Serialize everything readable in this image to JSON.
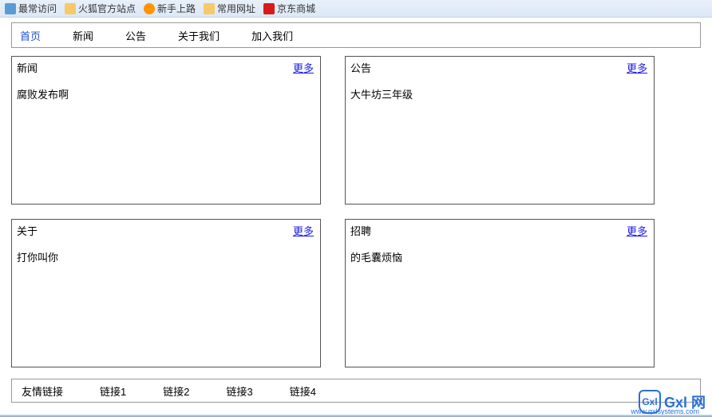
{
  "bookmarks": [
    {
      "label": "最常访问",
      "icon": "ico-blue"
    },
    {
      "label": "火狐官方站点",
      "icon": "ico-folder"
    },
    {
      "label": "新手上路",
      "icon": "ico-ff"
    },
    {
      "label": "常用网址",
      "icon": "ico-folder"
    },
    {
      "label": "京东商城",
      "icon": "ico-jd"
    }
  ],
  "nav": {
    "items": [
      "首页",
      "新闻",
      "公告",
      "关于我们",
      "加入我们"
    ],
    "active_index": 0
  },
  "more_label": "更多",
  "cards": [
    {
      "title": "新闻",
      "body": "腐败发布啊"
    },
    {
      "title": "公告",
      "body": "大牛坊三年级"
    },
    {
      "title": "关于",
      "body": "打你叫你"
    },
    {
      "title": "招聘",
      "body": "的毛囊烦恼"
    }
  ],
  "footer": {
    "label": "友情链接",
    "links": [
      "链接1",
      "链接2",
      "链接3",
      "链接4"
    ]
  },
  "watermark": {
    "shield_text": "Gxl",
    "main": "Gxl 网",
    "sub": "www.gxlsystems.com"
  }
}
